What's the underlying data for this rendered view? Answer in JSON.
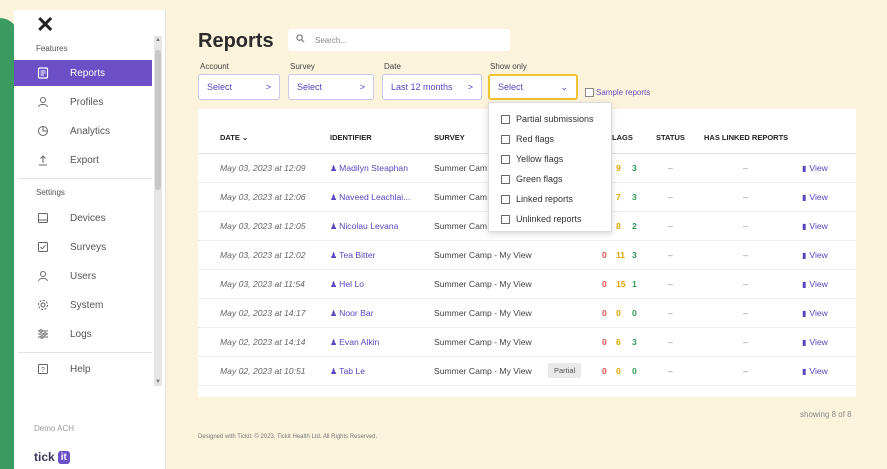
{
  "sidebar": {
    "close_label": "✕",
    "features_label": "Features",
    "features": [
      {
        "label": "Reports",
        "icon": "reports-icon",
        "active": true
      },
      {
        "label": "Profiles",
        "icon": "person-icon"
      },
      {
        "label": "Analytics",
        "icon": "analytics-icon"
      },
      {
        "label": "Export",
        "icon": "export-icon"
      }
    ],
    "settings_label": "Settings",
    "settings": [
      {
        "label": "Devices",
        "icon": "device-icon"
      },
      {
        "label": "Surveys",
        "icon": "survey-icon"
      },
      {
        "label": "Users",
        "icon": "users-icon"
      },
      {
        "label": "System",
        "icon": "gear-icon"
      },
      {
        "label": "Logs",
        "icon": "sliders-icon"
      }
    ],
    "help": {
      "label": "Help",
      "icon": "help-icon"
    },
    "org_label": "Demo ACH",
    "logo_text": "tick",
    "logo_mark": "it"
  },
  "header": {
    "title": "Reports",
    "search_placeholder": "Search..."
  },
  "filters": {
    "account": {
      "label": "Account",
      "value": "Select",
      "chevron": ">"
    },
    "survey": {
      "label": "Survey",
      "value": "Select",
      "chevron": ">"
    },
    "date": {
      "label": "Date",
      "value": "Last 12 months",
      "chevron": ">"
    },
    "show_only": {
      "label": "Show only",
      "value": "Select",
      "chevron": "⌄"
    },
    "sample_label": "Sample reports"
  },
  "table": {
    "headers": {
      "date": "DATE ⌄",
      "identifier": "IDENTIFIER",
      "survey": "SURVEY",
      "flags": "LAGS",
      "status": "STATUS",
      "linked": "HAS LINKED REPORTS"
    },
    "view_label": "View",
    "rows": [
      {
        "date": "May 03, 2023 at 12:09",
        "identifier": "Madilyn Steaphan",
        "survey": "Summer Cam",
        "partial": "",
        "red": "",
        "yellow": "9",
        "green": "3",
        "status": "–",
        "linked": "–"
      },
      {
        "date": "May 03, 2023 at 12:06",
        "identifier": "Naveed Leachlai...",
        "survey": "Summer Cam",
        "partial": "",
        "red": "",
        "yellow": "7",
        "green": "3",
        "status": "–",
        "linked": "–"
      },
      {
        "date": "May 03, 2023 at 12:05",
        "identifier": "Nicolau Levana",
        "survey": "Summer Cam",
        "partial": "",
        "red": "",
        "yellow": "8",
        "green": "2",
        "status": "–",
        "linked": "–"
      },
      {
        "date": "May 03, 2023 at 12:02",
        "identifier": "Tea Bitter",
        "survey": "Summer Camp - My View",
        "partial": "",
        "red": "0",
        "yellow": "11",
        "green": "3",
        "status": "–",
        "linked": "–"
      },
      {
        "date": "May 03, 2023 at 11:54",
        "identifier": "Hel Lo",
        "survey": "Summer Camp - My View",
        "partial": "",
        "red": "0",
        "yellow": "15",
        "green": "1",
        "status": "–",
        "linked": "–"
      },
      {
        "date": "May 02, 2023 at 14:17",
        "identifier": "Noor Bar",
        "survey": "Summer Camp - My View",
        "partial": "",
        "red": "0",
        "yellow": "0",
        "green": "0",
        "status": "–",
        "linked": "–"
      },
      {
        "date": "May 02, 2023 at 14:14",
        "identifier": "Evan Alkin",
        "survey": "Summer Camp - My View",
        "partial": "",
        "red": "0",
        "yellow": "6",
        "green": "3",
        "status": "–",
        "linked": "–"
      },
      {
        "date": "May 02, 2023 at 10:51",
        "identifier": "Tab Le",
        "survey": "Summer Camp - My View",
        "partial": "Partial",
        "red": "0",
        "yellow": "0",
        "green": "0",
        "status": "–",
        "linked": "–"
      }
    ]
  },
  "dropdown": {
    "options": [
      "Partial submissions",
      "Red flags",
      "Yellow flags",
      "Green flags",
      "Linked reports",
      "Unlinked reports"
    ]
  },
  "showing_text": "showing 8 of 8",
  "footer_text": "Designed with Tickit. © 2023, Tickit Health Ltd. All Rights Reserved.",
  "colors": {
    "accent": "#6a4fc7",
    "highlight": "#f1c232",
    "red_flag": "#e2574c",
    "yellow_flag": "#e0a400",
    "green_flag": "#2f9b57"
  }
}
